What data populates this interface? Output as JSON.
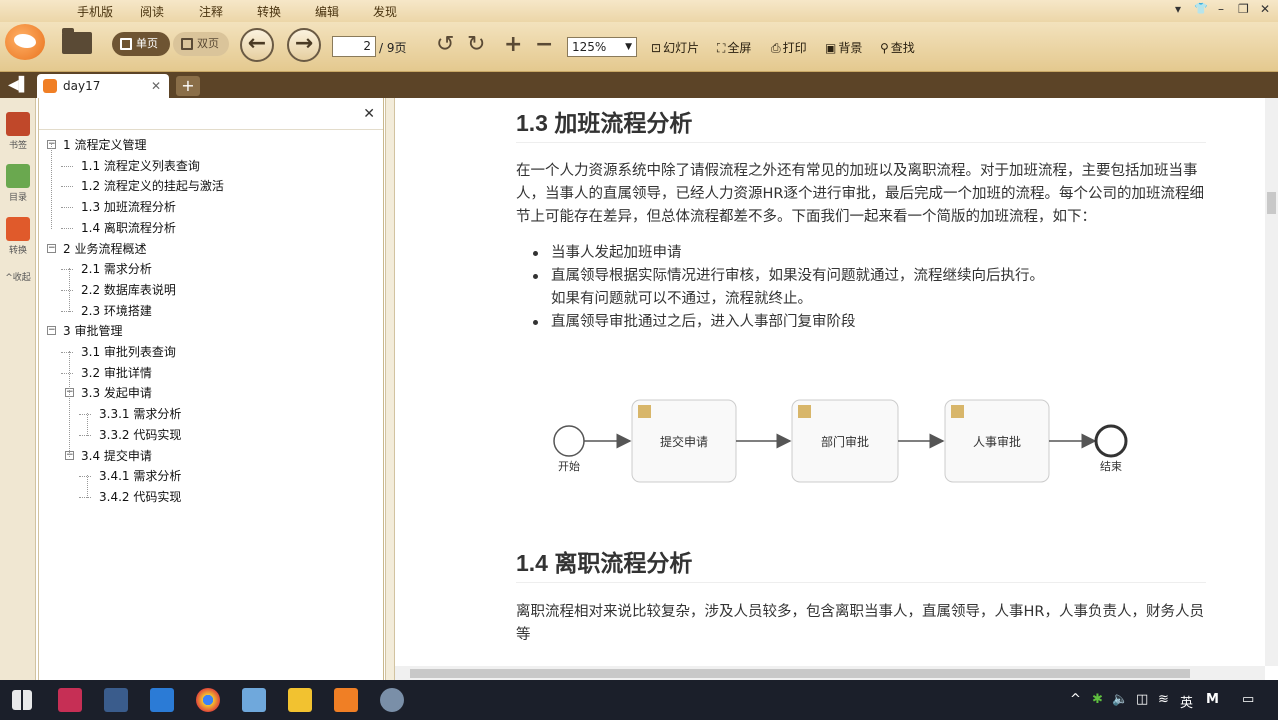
{
  "menubar": {
    "items": [
      "手机版",
      "阅读",
      "注释",
      "转换",
      "编辑",
      "发现"
    ]
  },
  "window_controls": [
    "▾",
    "👕",
    "–",
    "❐",
    "✕"
  ],
  "toolbar": {
    "view_single": "单页",
    "view_double": "双页",
    "page_current": "2",
    "page_total": "/ 9页",
    "zoom": "125%",
    "buttons": [
      {
        "icon": "slideshow-icon",
        "label": "幻灯片"
      },
      {
        "icon": "fullscreen-icon",
        "label": "全屏"
      },
      {
        "icon": "print-icon",
        "label": "打印"
      },
      {
        "icon": "background-icon",
        "label": "背景"
      },
      {
        "icon": "search-icon",
        "label": "查找"
      }
    ]
  },
  "tabs": [
    {
      "label": "day17"
    }
  ],
  "leftbar": {
    "items": [
      {
        "label": "书签",
        "color": "#c0482a"
      },
      {
        "label": "目录",
        "color": "#6aa84f"
      },
      {
        "label": "转换",
        "color": "#e05a2b"
      }
    ],
    "collapse": "^收起"
  },
  "toc": [
    {
      "label": "1 流程定义管理",
      "level": 0,
      "toggle": "−"
    },
    {
      "label": "1.1 流程定义列表查询",
      "level": 1
    },
    {
      "label": "1.2 流程定义的挂起与激活",
      "level": 1
    },
    {
      "label": "1.3 加班流程分析",
      "level": 1
    },
    {
      "label": "1.4 离职流程分析",
      "level": 1
    },
    {
      "label": "2 业务流程概述",
      "level": 0,
      "toggle": "−"
    },
    {
      "label": "2.1 需求分析",
      "level": 1
    },
    {
      "label": "2.2 数据库表说明",
      "level": 1
    },
    {
      "label": "2.3 环境搭建",
      "level": 1
    },
    {
      "label": "3 审批管理",
      "level": 0,
      "toggle": "−"
    },
    {
      "label": "3.1 审批列表查询",
      "level": 1
    },
    {
      "label": "3.2 审批详情",
      "level": 1
    },
    {
      "label": "3.3 发起申请",
      "level": 1,
      "toggle": "−"
    },
    {
      "label": "3.3.1 需求分析",
      "level": 2
    },
    {
      "label": "3.3.2 代码实现",
      "level": 2
    },
    {
      "label": "3.4 提交申请",
      "level": 1,
      "toggle": "−"
    },
    {
      "label": "3.4.1 需求分析",
      "level": 2
    },
    {
      "label": "3.4.2 代码实现",
      "level": 2
    }
  ],
  "doc": {
    "section1_title": "1.3 加班流程分析",
    "section1_para": "在一个人力资源系统中除了请假流程之外还有常见的加班以及离职流程。对于加班流程，主要包括加班当事人，当事人的直属领导，已经人力资源HR逐个进行审批，最后完成一个加班的流程。每个公司的加班流程细节上可能存在差异，但总体流程都差不多。下面我们一起来看一个简版的加班流程，如下：",
    "bullets": [
      "当事人发起加班申请",
      "直属领导根据实际情况进行审核，如果没有问题就通过，流程继续向后执行。\n如果有问题就可以不通过，流程就终止。",
      "直属领导审批通过之后，进入人事部门复审阶段"
    ],
    "flow": {
      "start": "开始",
      "tasks": [
        "提交申请",
        "部门审批",
        "人事审批"
      ],
      "end": "结束"
    },
    "section2_title": "1.4 离职流程分析",
    "section2_para": "离职流程相对来说比较复杂，涉及人员较多，包含离职当事人，直属领导，人事HR，人事负责人，财务人员等"
  },
  "taskbar": {
    "tray": [
      "^",
      "英",
      "M"
    ]
  }
}
